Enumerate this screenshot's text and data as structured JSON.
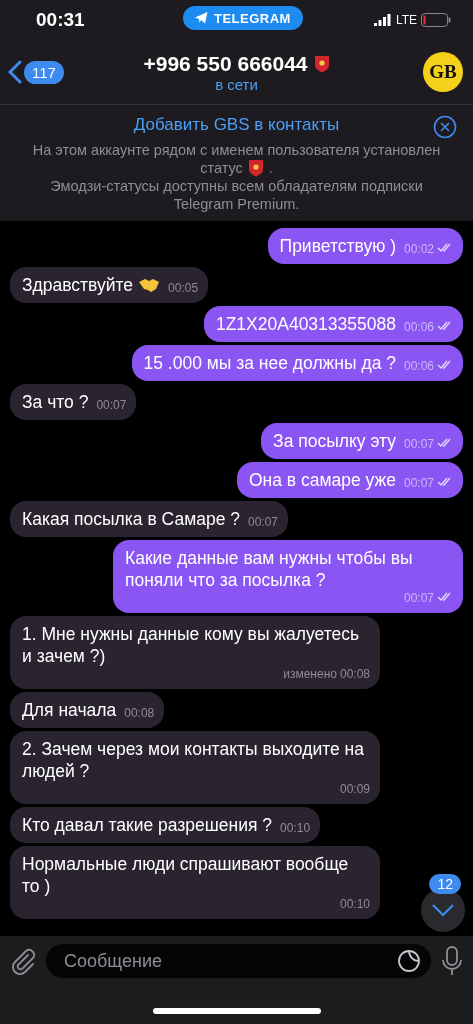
{
  "status_bar": {
    "time": "00:31",
    "app_pill": "TELEGRAM",
    "network": "LTE",
    "battery_low": true
  },
  "header": {
    "back_count": "117",
    "title": "+996 550 666044",
    "subtitle": "в сети",
    "avatar_text": "GB"
  },
  "banner": {
    "action": "Добавить GBS в контакты",
    "line_1": "На этом аккаунте рядом с именем пользователя установлен",
    "line_1_status": "статус",
    "line_1_end": ".",
    "line_2": "Эмодзи-статусы доступны всем обладателям подписки Telegram Premium."
  },
  "messages": [
    {
      "kind": "out",
      "text": "Приветствую )",
      "time": "00:02",
      "read": true
    },
    {
      "kind": "in",
      "text": "Здравствуйте",
      "handshake_emoji": true,
      "time": "00:05"
    },
    {
      "kind": "out",
      "text": "1Z1X20A40313355088",
      "time": "00:06",
      "read": true
    },
    {
      "kind": "out",
      "text": "15 .000 мы за нее должны да ?",
      "time": "00:06",
      "read": true
    },
    {
      "kind": "in",
      "text": "За что ?",
      "time": "00:07"
    },
    {
      "kind": "out",
      "text": "За посылку эту",
      "time": "00:07",
      "read": true
    },
    {
      "kind": "out",
      "text": "Она в самаре уже",
      "time": "00:07",
      "read": true
    },
    {
      "kind": "in",
      "text": "Какая посылка в Самаре ?",
      "time": "00:07"
    },
    {
      "kind": "out",
      "text": "Какие данные вам нужны чтобы вы поняли что за посылка ?",
      "time": "00:07",
      "read": true
    },
    {
      "kind": "in",
      "text": "1. Мне нужны данные кому вы жалуетесь и зачем ?)",
      "edited": "изменено",
      "time": "00:08"
    },
    {
      "kind": "in",
      "text": "Для начала",
      "time": "00:08"
    },
    {
      "kind": "in",
      "text": "2. Зачем через мои контакты выходите на людей ?",
      "time": "00:09"
    },
    {
      "kind": "in",
      "text": "Кто давал такие разрешения ?",
      "time": "00:10"
    },
    {
      "kind": "in",
      "text": "Нормальные люди спрашивают вообще то )",
      "time": "00:10"
    }
  ],
  "scroll_button": {
    "unread": "12"
  },
  "composer": {
    "placeholder": "Сообщение"
  }
}
